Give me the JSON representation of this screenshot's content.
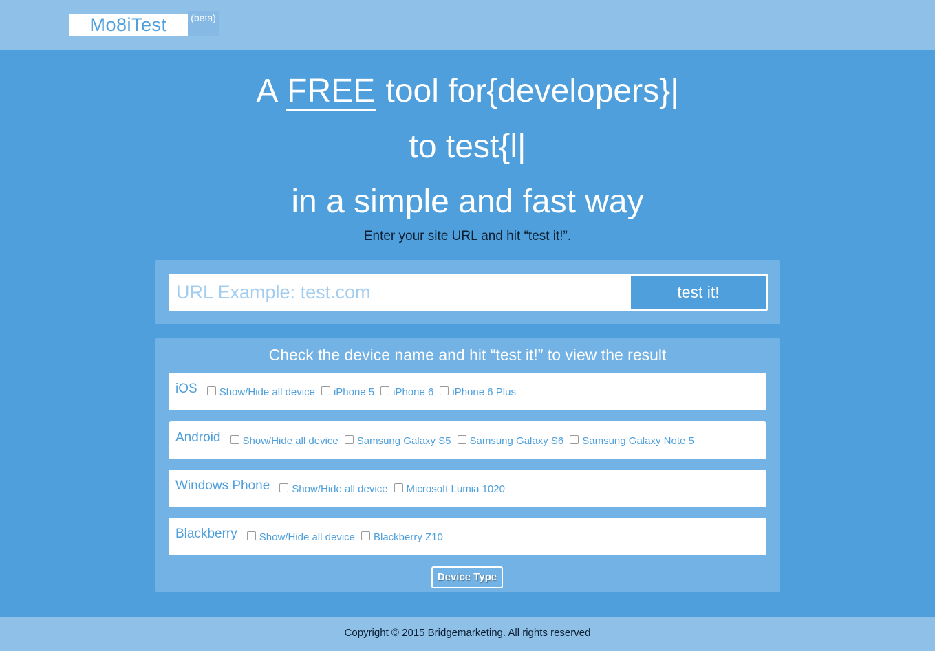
{
  "header": {
    "logo": "Mo8iTest",
    "beta": "(beta)"
  },
  "hero": {
    "line1_prefix": "A ",
    "line1_free": "FREE",
    "line1_suffix": " tool for{developers}",
    "line1_caret": "|",
    "line2": "to test{l",
    "line2_caret": "|",
    "line3": "in a simple and fast way",
    "instruction": "Enter your site URL and hit “test it!”."
  },
  "url_form": {
    "placeholder": "URL Example: test.com",
    "value": "",
    "button_label": "test it!"
  },
  "devices": {
    "title": "Check the device name and hit “test it!” to view the result",
    "groups": [
      {
        "name": "iOS",
        "options": [
          {
            "label": "Show/Hide all device",
            "checked": false
          },
          {
            "label": "iPhone 5",
            "checked": false
          },
          {
            "label": "iPhone 6",
            "checked": false
          },
          {
            "label": "iPhone 6 Plus",
            "checked": false
          }
        ]
      },
      {
        "name": "Android",
        "options": [
          {
            "label": "Show/Hide all device",
            "checked": false
          },
          {
            "label": "Samsung Galaxy S5",
            "checked": false
          },
          {
            "label": "Samsung Galaxy S6",
            "checked": false
          },
          {
            "label": "Samsung Galaxy Note 5",
            "checked": false
          }
        ]
      },
      {
        "name": "Windows Phone",
        "options": [
          {
            "label": "Show/Hide all device",
            "checked": false
          },
          {
            "label": "Microsoft Lumia 1020",
            "checked": false
          }
        ]
      },
      {
        "name": "Blackberry",
        "options": [
          {
            "label": "Show/Hide all device",
            "checked": false
          },
          {
            "label": "Blackberry Z10",
            "checked": false
          }
        ]
      }
    ],
    "device_type_button": "Device Type"
  },
  "footer": {
    "copyright": "Copyright © 2015 Bridgemarketing. All rights reserved"
  },
  "colors": {
    "background": "#4e9fdb",
    "header_footer": "#8ec0e8",
    "panel": "#73b2e4",
    "accent": "#4e9fdb",
    "text_dark": "#0d1f33"
  }
}
